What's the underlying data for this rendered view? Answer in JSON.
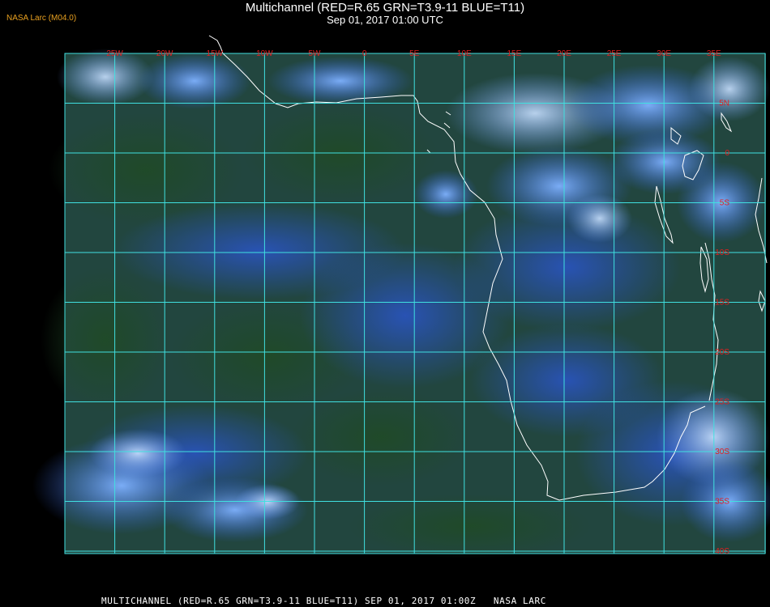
{
  "header": {
    "brand": "NASA Larc (M04.0)",
    "title": "Multichannel (RED=R.65 GRN=T3.9-11 BLUE=T11)",
    "subtitle": "Sep 01, 2017 01:00 UTC"
  },
  "footer": {
    "text": "MULTICHANNEL (RED=R.65 GRN=T3.9-11 BLUE=T11) SEP 01, 2017 01:00Z   NASA LARC"
  },
  "grid": {
    "lon_labels": [
      "25W",
      "20W",
      "15W",
      "10W",
      "5W",
      "0",
      "5E",
      "10E",
      "15E",
      "20E",
      "25E",
      "30E",
      "35E"
    ],
    "lat_labels": [
      "5N",
      "0",
      "5S",
      "10S",
      "15S",
      "20S",
      "25S",
      "30S",
      "35S",
      "40S"
    ]
  },
  "colors": {
    "grid": "#40e0e0",
    "tick_label": "#e02020",
    "coast": "#ffffff",
    "brand": "#e8a020"
  }
}
